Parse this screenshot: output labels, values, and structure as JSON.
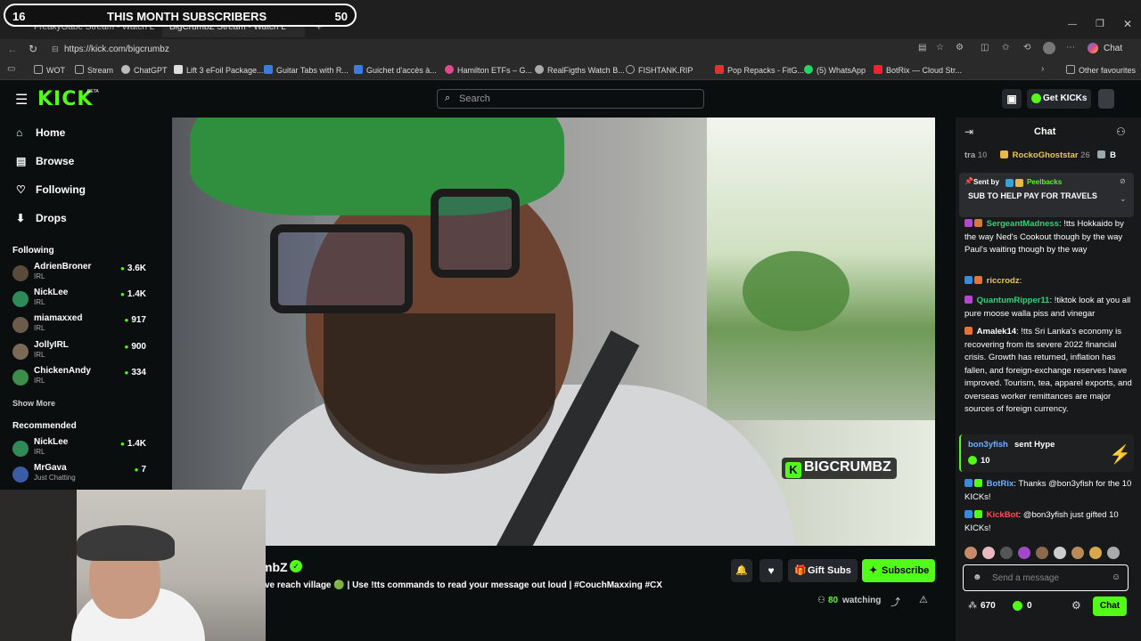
{
  "overlay": {
    "left_num": "16",
    "title": "THIS MONTH SUBSCRIBERS",
    "right_num": "50"
  },
  "browser": {
    "tabs": [
      "FreakyGabe Stream - Watch L",
      "BigCrumbZ Stream - Watch L"
    ],
    "url": "https://kick.com/bigcrumbz",
    "profile_label": "Chat",
    "bookmarks": [
      {
        "label": "WOT",
        "color": "#888"
      },
      {
        "label": "Stream",
        "color": "#888"
      },
      {
        "label": "ChatGPT",
        "color": "#bbb"
      },
      {
        "label": "Lift 3 eFoil Package...",
        "color": "#ddd"
      },
      {
        "label": "Guitar Tabs with R...",
        "color": "#aaa"
      },
      {
        "label": "Guichet d'accès à...",
        "color": "#3b7ddd"
      },
      {
        "label": "Hamilton ETFs – G...",
        "color": "#e04a8a"
      },
      {
        "label": "RealFigths Watch B...",
        "color": "#aaa"
      },
      {
        "label": "FISHTANK.RIP",
        "color": "#aaa"
      },
      {
        "label": "Pop Repacks - FitG...",
        "color": "#d33"
      },
      {
        "label": "(5) WhatsApp",
        "color": "#25d366"
      },
      {
        "label": "BotRix — Cloud Str...",
        "color": "#e23"
      }
    ],
    "other_favourites": "Other favourites"
  },
  "header": {
    "logo": "KICK",
    "logo_sup": "BETA",
    "search_placeholder": "Search",
    "get_kicks": "Get KICKs"
  },
  "sidebar": {
    "nav": [
      {
        "label": "Home",
        "icon": "home-icon"
      },
      {
        "label": "Browse",
        "icon": "browse-icon"
      },
      {
        "label": "Following",
        "icon": "heart-icon"
      },
      {
        "label": "Drops",
        "icon": "drops-icon"
      }
    ],
    "following_title": "Following",
    "following": [
      {
        "name": "AdrienBroner",
        "category": "IRL",
        "viewers": "3.6K"
      },
      {
        "name": "NickLee",
        "category": "IRL",
        "viewers": "1.4K"
      },
      {
        "name": "miamaxxed",
        "category": "IRL",
        "viewers": "917"
      },
      {
        "name": "JollyIRL",
        "category": "IRL",
        "viewers": "900"
      },
      {
        "name": "ChickenAndy",
        "category": "IRL",
        "viewers": "334"
      }
    ],
    "show_more": "Show More",
    "recommended_title": "Recommended",
    "recommended": [
      {
        "name": "NickLee",
        "category": "IRL",
        "viewers": "1.4K"
      },
      {
        "name": "MrGava",
        "category": "Just Chatting",
        "viewers": "7"
      }
    ]
  },
  "stream": {
    "watermark": "BIGCRUMBZ",
    "streamer_name_partial": "mbZ",
    "title_partial": "ve reach village 🟢 | Use !tts commands to read your message out loud | #CouchMaxxing #CX",
    "gift_subs": "Gift Subs",
    "subscribe": "Subscribe",
    "watching_count": "80",
    "watching_label": "watching"
  },
  "chat": {
    "title": "Chat",
    "top_row": {
      "left": "tra",
      "left_num": "10",
      "name": "RockoGhoststar",
      "num": "26",
      "tail": "B"
    },
    "pinned": {
      "sent_by": "Sent by",
      "user": "Peelbacks",
      "text": "SUB TO HELP PAY FOR TRAVELS"
    },
    "messages": [
      {
        "user": "SergeantMadness",
        "color": "#2fd37b",
        "text": "!tts Hokkaido by the way Ned's Cookout though by the way Paul's waiting though by the way"
      },
      {
        "user": "riccrodz",
        "color": "#e9c65a",
        "text": ""
      },
      {
        "user": "QuantumRipper11",
        "color": "#2fd37b",
        "text": "!tiktok look at you all pure moose walla piss and vinegar"
      },
      {
        "user": "Amalek14",
        "color": "#ffffff",
        "text": "!tts Sri Lanka's economy is recovering from its severe 2022 financial crisis. Growth has returned, inflation has fallen, and foreign-exchange reserves have improved. Tourism, tea, apparel exports, and overseas worker remittances are major sources of foreign currency."
      }
    ],
    "hype": {
      "user": "bon3yfish",
      "action": "sent Hype",
      "amount": "10"
    },
    "bot_messages": [
      {
        "user": "BotRix",
        "color": "#6fb1ff",
        "text": "Thanks @bon3yfish for the 10 KICKs!"
      },
      {
        "user": "KickBot",
        "color": "#ff4b5c",
        "text": "@bon3yfish just gifted 10 KICKs!"
      }
    ],
    "input_placeholder": "Send a message",
    "kicks_count": "670",
    "coins_count": "0",
    "send_label": "Chat"
  }
}
